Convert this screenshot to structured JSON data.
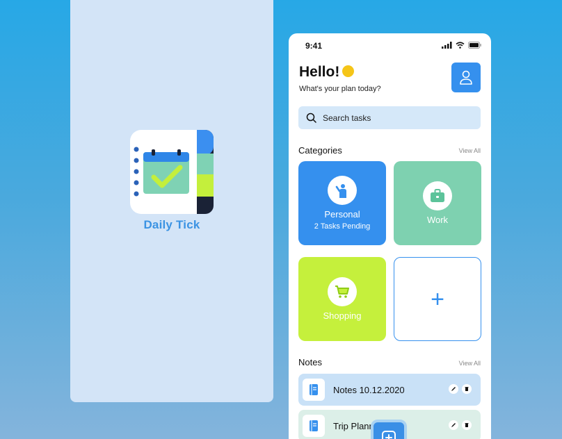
{
  "splash": {
    "app_name": "Daily Tick"
  },
  "phone": {
    "status_time": "9:41",
    "greeting": "Hello!",
    "subgreeting": "What's your plan today?",
    "search": {
      "placeholder": "Search tasks"
    },
    "categories": {
      "title": "Categories",
      "view_all": "View All",
      "personal": {
        "label": "Personal",
        "sub": "2 Tasks Pending",
        "color": "#3590ee"
      },
      "work": {
        "label": "Work",
        "color": "#7ed1b0"
      },
      "shopping": {
        "label": "Shopping",
        "color": "#c5f03c"
      },
      "add": {
        "symbol": "+"
      }
    },
    "notes": {
      "title": "Notes",
      "view_all": "View All",
      "items": [
        {
          "title": "Notes 10.12.2020",
          "color": "#c9e1f7"
        },
        {
          "title": "Trip Planning",
          "color": "#dcefe8"
        }
      ]
    }
  },
  "colors": {
    "accent": "#3590ee",
    "background": "#27a8e6",
    "splash_bg": "#d3e4f7"
  }
}
